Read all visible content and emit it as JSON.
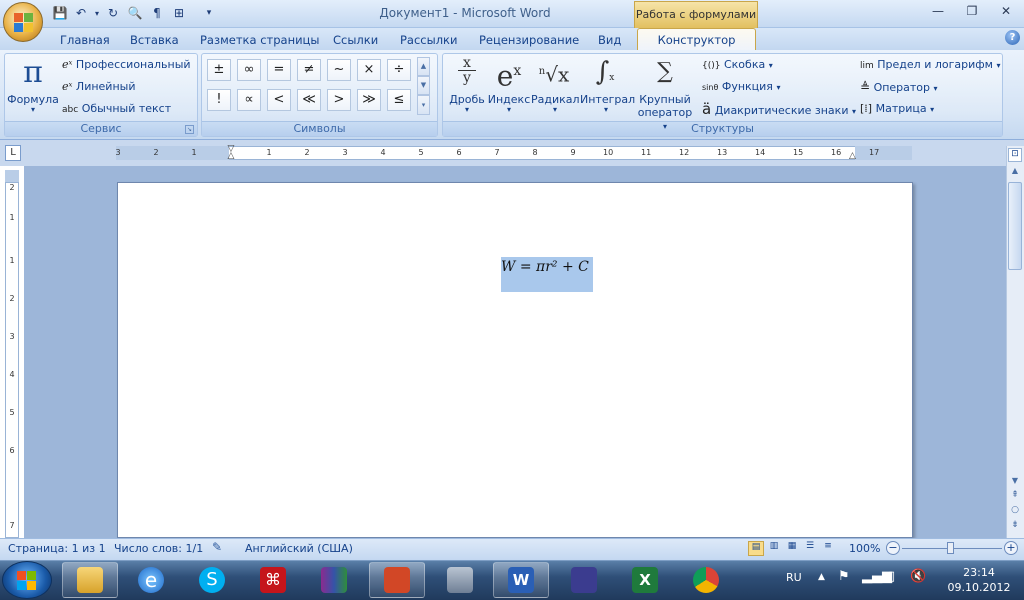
{
  "window": {
    "title": "Документ1 - Microsoft Word",
    "context_tab_group": "Работа с формулами"
  },
  "tabs": [
    "Главная",
    "Вставка",
    "Разметка страницы",
    "Ссылки",
    "Рассылки",
    "Рецензирование",
    "Вид",
    "Конструктор"
  ],
  "ribbon": {
    "service": {
      "group_label": "Сервис",
      "formula_label": "Формула",
      "professional_label": "Профессиональный",
      "linear_label": "Линейный",
      "plain_text_label": "Обычный текст",
      "plain_text_prefix": "abc"
    },
    "symbols": {
      "group_label": "Символы",
      "items": [
        "±",
        "∞",
        "=",
        "≠",
        "~",
        "×",
        "÷",
        "!",
        "∝",
        "<",
        "≪",
        ">",
        "≫",
        "≤"
      ]
    },
    "structures": {
      "group_label": "Структуры",
      "fraction_label": "Дробь",
      "index_label": "Индекс",
      "radical_label": "Радикал",
      "integral_label": "Интеграл",
      "large_operator_label_1": "Крупный",
      "large_operator_label_2": "оператор",
      "bracket_label": "Скобка",
      "function_label": "Функция",
      "accent_label": "Диакритические знаки",
      "limit_label": "Предел и логарифм",
      "operator_label": "Оператор",
      "matrix_label": "Матрица",
      "bracket_icon": "{()}",
      "function_icon": "sinθ",
      "limit_icon": "lim"
    }
  },
  "ruler": {
    "ticks": [
      "3",
      "2",
      "1",
      "1",
      "2",
      "3",
      "4",
      "5",
      "6",
      "7",
      "8",
      "9",
      "10",
      "11",
      "12",
      "13",
      "14",
      "15",
      "16",
      "17"
    ],
    "vticks": [
      "2",
      "1",
      "1",
      "2",
      "3",
      "4",
      "5",
      "6",
      "7"
    ]
  },
  "document": {
    "equation": "W = πr² + C"
  },
  "statusbar": {
    "page": "Страница: 1 из 1",
    "words": "Число слов: 1/1",
    "language": "Английский (США)",
    "zoom": "100%"
  },
  "taskbar": {
    "language": "RU",
    "time": "23:14",
    "date": "09.10.2012"
  },
  "colors": {
    "accent": "#15428b",
    "context_tab": "#e2c060",
    "equation_highlight": "#a9c8ec"
  }
}
